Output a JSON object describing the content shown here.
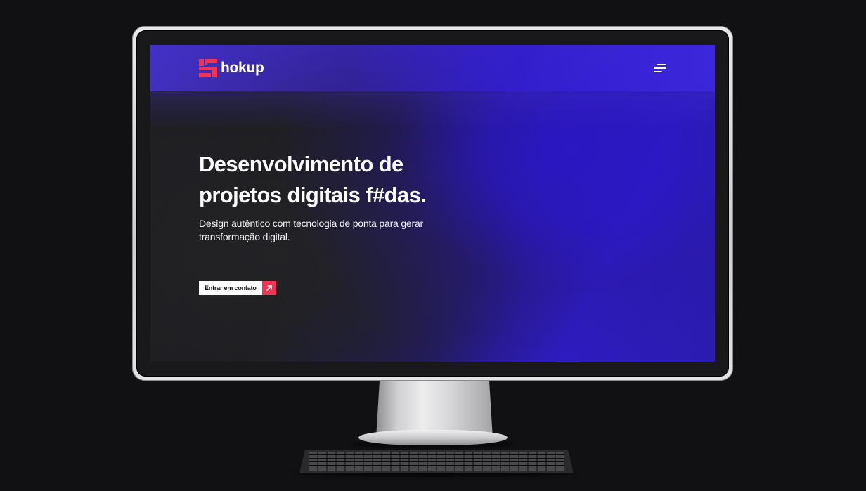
{
  "site": {
    "brand": "hokup",
    "hero": {
      "title_line1": "Desenvolvimento de",
      "title_line2": "projetos digitais f#das.",
      "subtitle_line1": "Design autêntico com tecnologia de ponta para gerar",
      "subtitle_line2": "transformação digital."
    },
    "cta_label": "Entrar em contato"
  },
  "icons": {
    "logo": "hokup-logo-mark",
    "menu": "hamburger-menu-icon",
    "cta_arrow": "arrow-up-right-icon"
  },
  "colors": {
    "accent": "#ee3558",
    "brand_purple": "#2b17c4",
    "screen_dark": "#1f1f23",
    "backdrop": "#111114"
  }
}
